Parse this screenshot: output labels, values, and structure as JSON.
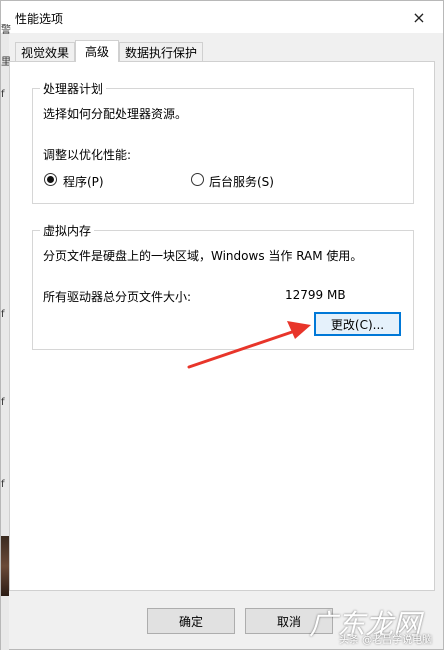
{
  "window": {
    "title": "性能选项",
    "close_icon": "×"
  },
  "tabs": [
    {
      "label": "视觉效果",
      "active": false
    },
    {
      "label": "高级",
      "active": true
    },
    {
      "label": "数据执行保护",
      "active": false
    }
  ],
  "processor": {
    "group_title": "处理器计划",
    "description": "选择如何分配处理器资源。",
    "adjust_label": "调整以优化性能:",
    "options": [
      {
        "label": "程序(P)",
        "checked": true
      },
      {
        "label": "后台服务(S)",
        "checked": false
      }
    ]
  },
  "virtual_memory": {
    "group_title": "虚拟内存",
    "description": "分页文件是硬盘上的一块区域，Windows 当作 RAM 使用。",
    "total_label": "所有驱动器总分页文件大小:",
    "total_value": "12799 MB",
    "change_button": "更改(C)..."
  },
  "footer": {
    "ok": "确定",
    "cancel": "取消"
  },
  "behind_glyphs": [
    "警",
    "里",
    "f",
    "f",
    "f",
    "f"
  ],
  "watermark": {
    "big": "广东龙网",
    "small": "头条 @老吕学说电脑"
  },
  "colors": {
    "annotation_arrow": "#e8352a",
    "focus_border": "#0078d7"
  }
}
